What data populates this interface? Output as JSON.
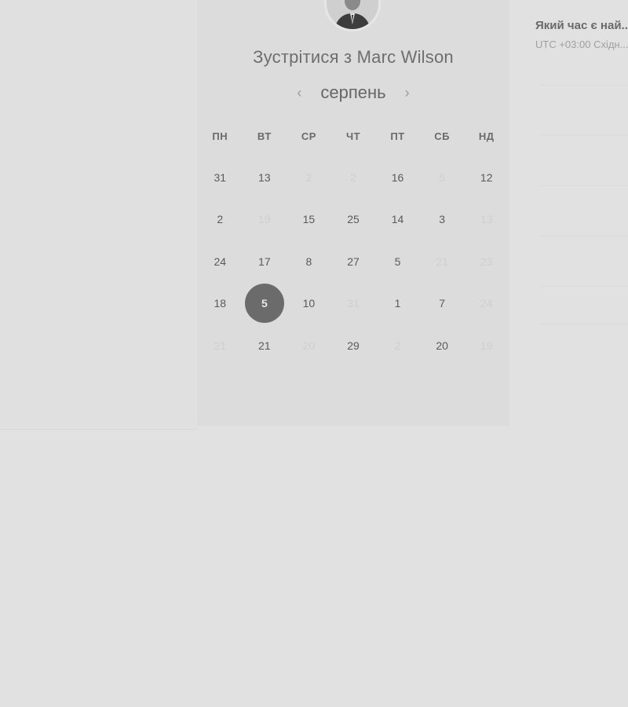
{
  "scheduler": {
    "title": "Зустрітися з Marc Wilson",
    "month": "серпень",
    "prev_icon": "chevron-left-icon",
    "next_icon": "chevron-right-icon",
    "weekdays": [
      "ПН",
      "ВТ",
      "СР",
      "ЧТ",
      "ПТ",
      "СБ",
      "НД"
    ],
    "weeks": [
      [
        {
          "label": "31",
          "state": "available"
        },
        {
          "label": "13",
          "state": "available"
        },
        {
          "label": "2",
          "state": "disabled"
        },
        {
          "label": "2",
          "state": "disabled"
        },
        {
          "label": "16",
          "state": "available"
        },
        {
          "label": "5",
          "state": "disabled"
        },
        {
          "label": "12",
          "state": "available"
        }
      ],
      [
        {
          "label": "2",
          "state": "available"
        },
        {
          "label": "19",
          "state": "disabled"
        },
        {
          "label": "15",
          "state": "available"
        },
        {
          "label": "25",
          "state": "available"
        },
        {
          "label": "14",
          "state": "available"
        },
        {
          "label": "3",
          "state": "available"
        },
        {
          "label": "13",
          "state": "disabled"
        }
      ],
      [
        {
          "label": "24",
          "state": "available"
        },
        {
          "label": "17",
          "state": "available"
        },
        {
          "label": "8",
          "state": "available"
        },
        {
          "label": "27",
          "state": "available"
        },
        {
          "label": "5",
          "state": "available"
        },
        {
          "label": "21",
          "state": "disabled"
        },
        {
          "label": "23",
          "state": "disabled"
        }
      ],
      [
        {
          "label": "18",
          "state": "available"
        },
        {
          "label": "5",
          "state": "selected"
        },
        {
          "label": "10",
          "state": "available"
        },
        {
          "label": "31",
          "state": "disabled"
        },
        {
          "label": "1",
          "state": "available"
        },
        {
          "label": "7",
          "state": "available"
        },
        {
          "label": "24",
          "state": "disabled"
        }
      ],
      [
        {
          "label": "21",
          "state": "disabled"
        },
        {
          "label": "21",
          "state": "available"
        },
        {
          "label": "20",
          "state": "disabled"
        },
        {
          "label": "29",
          "state": "available"
        },
        {
          "label": "2",
          "state": "disabled"
        },
        {
          "label": "20",
          "state": "available"
        },
        {
          "label": "19",
          "state": "disabled"
        }
      ]
    ]
  },
  "time_panel": {
    "question": "Який час є най...",
    "timezone": "UTC +03:00 Східн..."
  },
  "colors": {
    "page_bg": "#e1e1e1",
    "card_bg": "#dcdcdc",
    "selected_day_bg": "#6b6b6b"
  }
}
